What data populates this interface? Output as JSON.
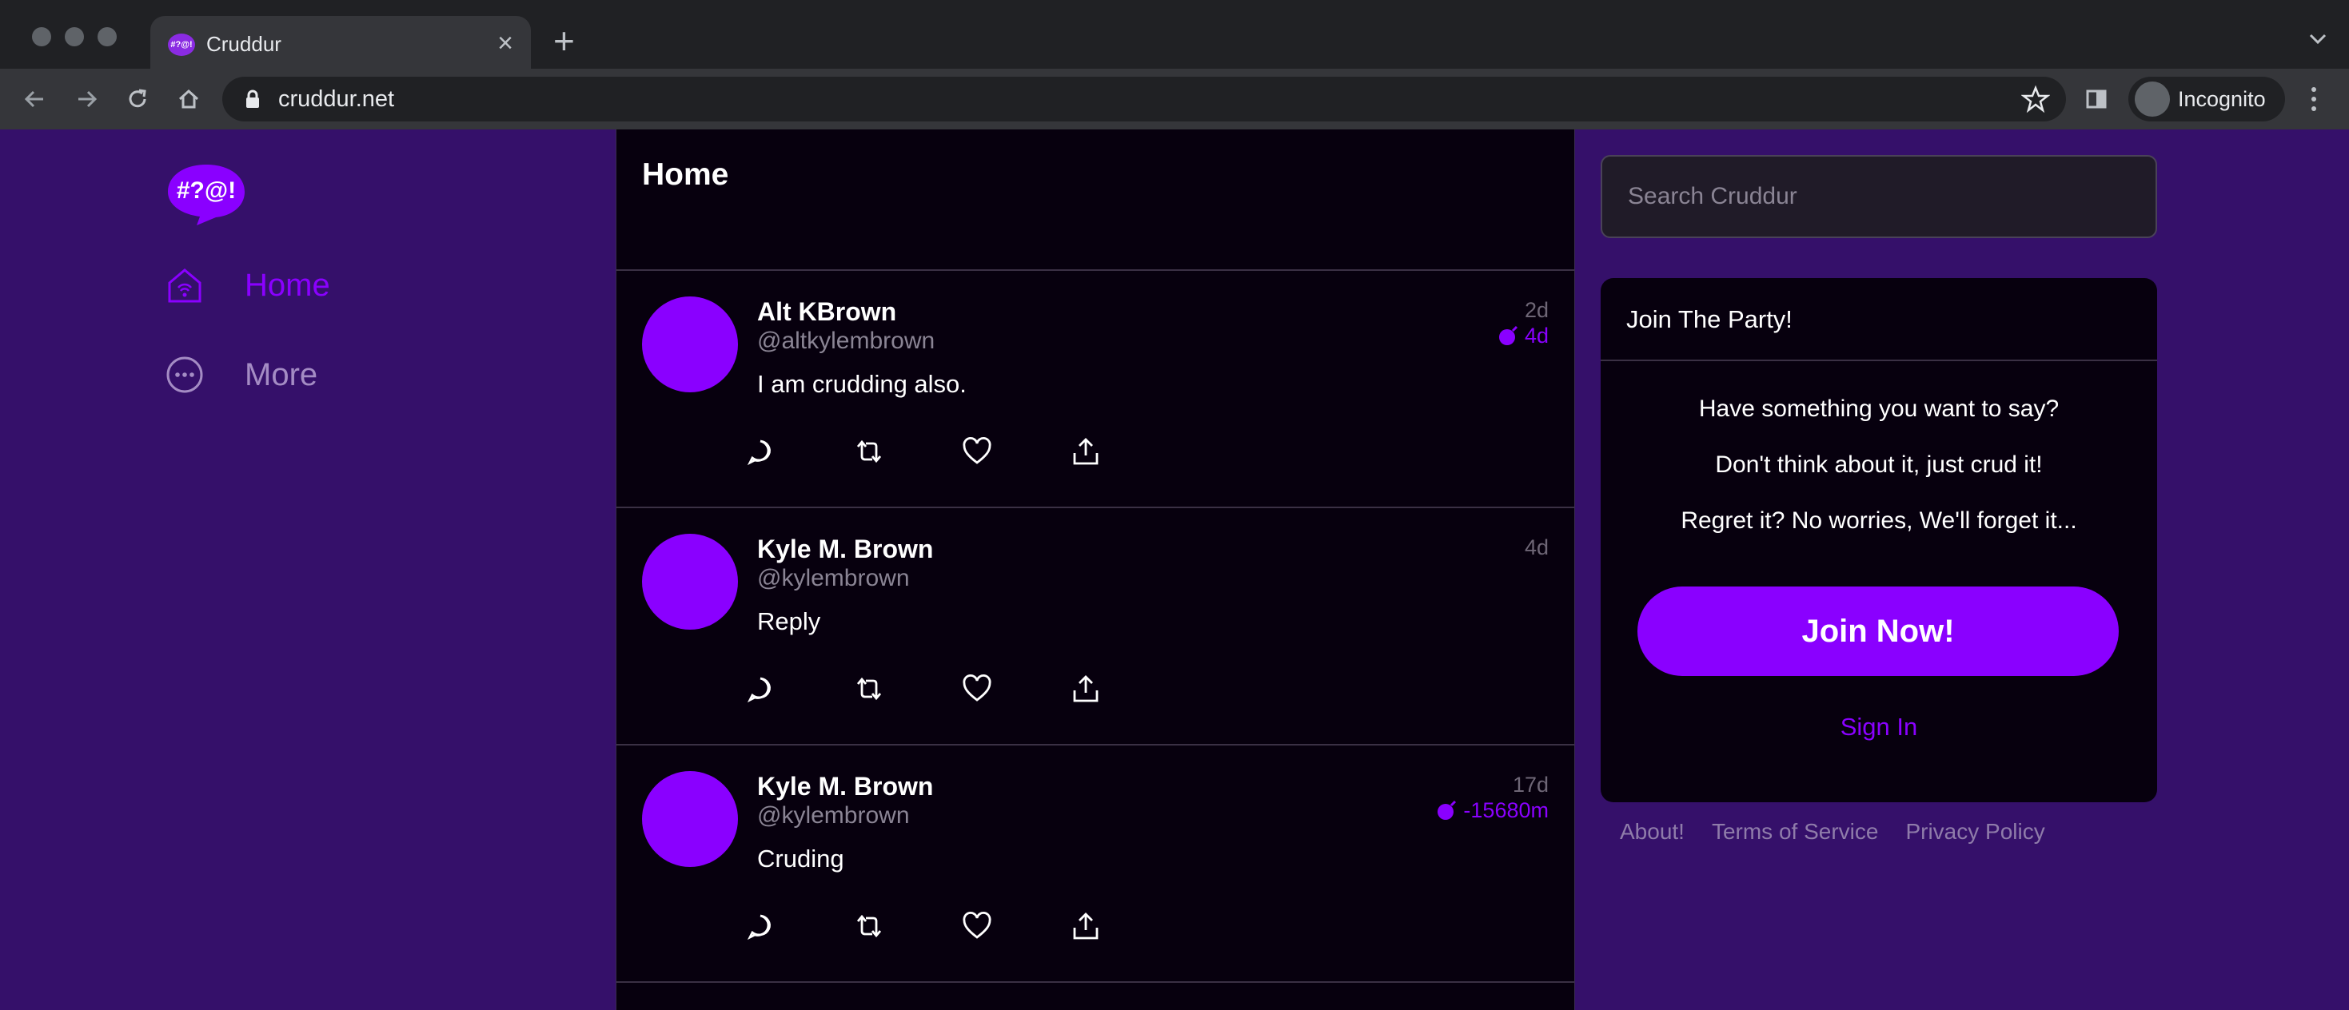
{
  "browser": {
    "tab_title": "Cruddur",
    "tab_favicon_text": "#?@!",
    "tab_close": "×",
    "new_tab": "+",
    "url": "cruddur.net",
    "profile": "Incognito"
  },
  "brand": {
    "logo_text": "#?@!",
    "logo_color": "#8a00ff"
  },
  "sidebar": {
    "items": [
      {
        "label": "Home",
        "icon": "home-icon",
        "active": true
      },
      {
        "label": "More",
        "icon": "more-icon",
        "active": false
      }
    ]
  },
  "feed": {
    "title": "Home",
    "posts": [
      {
        "name": "Alt KBrown",
        "handle": "@altkylembrown",
        "message": "I am crudding also.",
        "age": "2d",
        "expires": "4d"
      },
      {
        "name": "Kyle M. Brown",
        "handle": "@kylembrown",
        "message": "Reply",
        "age": "4d",
        "expires": ""
      },
      {
        "name": "Kyle M. Brown",
        "handle": "@kylembrown",
        "message": "Cruding",
        "age": "17d",
        "expires": "-15680m"
      }
    ],
    "actions": [
      "reply-icon",
      "repost-icon",
      "like-icon",
      "share-icon"
    ]
  },
  "search": {
    "placeholder": "Search Cruddur"
  },
  "join_card": {
    "title": "Join The Party!",
    "lines": [
      "Have something you want to say?",
      "Don't think about it, just crud it!",
      "Regret it? No worries, We'll forget it..."
    ],
    "join_button": "Join Now!",
    "sign_in": "Sign In"
  },
  "footer": {
    "links": [
      "About!",
      "Terms of Service",
      "Privacy Policy"
    ]
  },
  "colors": {
    "accent": "#8a00ff",
    "background": "#35106a",
    "panel": "#07000e"
  }
}
